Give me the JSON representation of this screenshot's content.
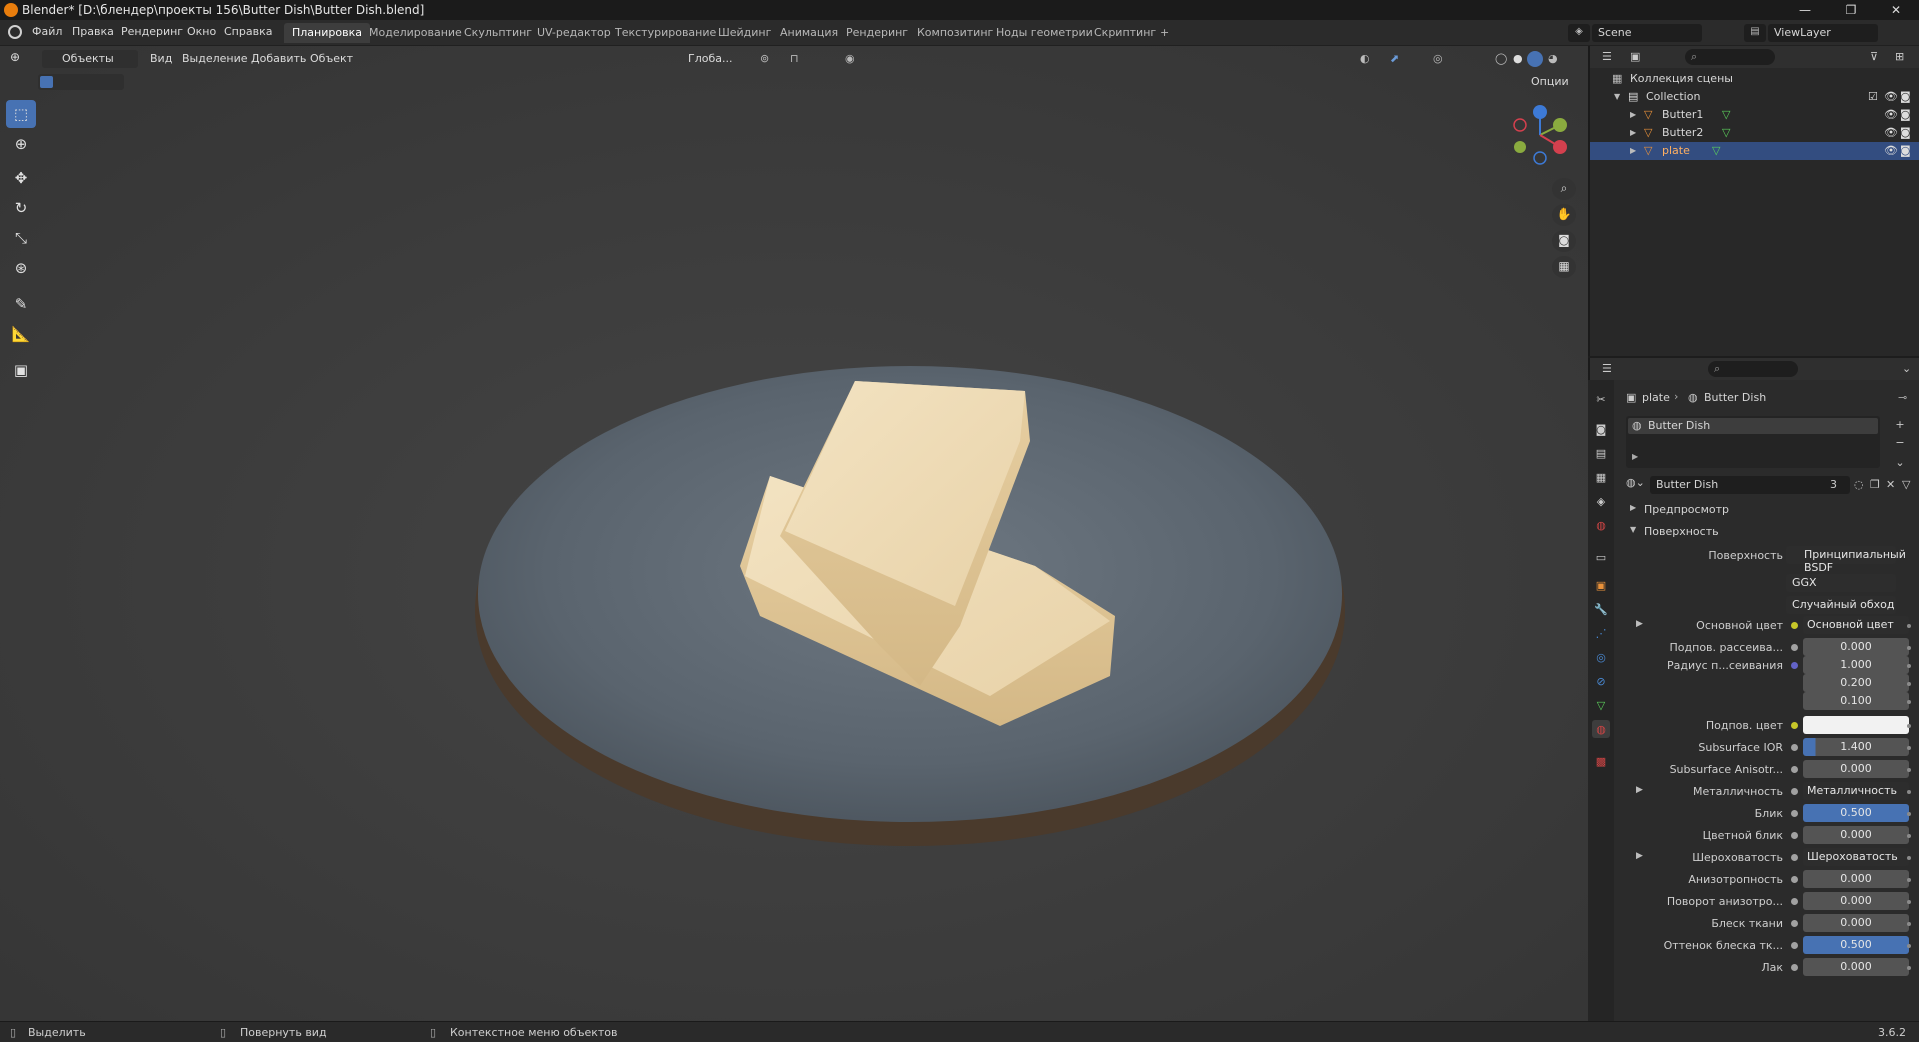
{
  "window": {
    "title": "Blender* [D:\\блендер\\проекты 156\\Butter Dish\\Butter Dish.blend]",
    "minimize": "—",
    "maximize": "❐",
    "close": "✕"
  },
  "menu": [
    "Файл",
    "Правка",
    "Рендеринг",
    "Окно",
    "Справка"
  ],
  "workspaces": [
    "Планировка",
    "Моделирование",
    "Скульптинг",
    "UV-редактор",
    "Текстурирование",
    "Шейдинг",
    "Анимация",
    "Рендеринг",
    "Композитинг",
    "Ноды геометрии",
    "Скриптинг"
  ],
  "workspace_active": "Планировка",
  "workspace_add": "+",
  "scene": {
    "name": "Scene",
    "view_layer": "ViewLayer"
  },
  "viewport_header": {
    "mode": "Объекты",
    "menus": [
      "Вид",
      "Выделение",
      "Добавить",
      "Объект"
    ],
    "transform_orientation": "Глоба...",
    "options": "Опции"
  },
  "outliner": {
    "scene_collection": "Коллекция сцены",
    "collection": "Collection",
    "objects": [
      {
        "name": "Butter1",
        "selected": false
      },
      {
        "name": "Butter2",
        "selected": false
      },
      {
        "name": "plate",
        "selected": true
      }
    ]
  },
  "properties": {
    "breadcrumb_object": "plate",
    "breadcrumb_material": "Butter Dish",
    "slot_name": "Butter Dish",
    "material_name": "Butter Dish",
    "user_count": "3",
    "sections": {
      "preview": "Предпросмотр",
      "surface": "Поверхность"
    },
    "surface_label": "Поверхность",
    "surface_shader": "Принципиальный BSDF",
    "distribution": "GGX",
    "subsurface_method": "Случайный обход",
    "rows": [
      {
        "label": "Основной цвет",
        "value": "Основной цвет",
        "kind": "link",
        "dot": "#c7c729",
        "expand": true
      },
      {
        "label": "Подпов. рассеива...",
        "value": "0.000",
        "kind": "num",
        "dot": "#a1a1a1"
      },
      {
        "label": "Радиус п...сеивания",
        "value": "1.000",
        "kind": "num",
        "dot": "#6363c7"
      },
      {
        "label": "",
        "value": "0.200",
        "kind": "num"
      },
      {
        "label": "",
        "value": "0.100",
        "kind": "num"
      },
      {
        "label": "Подпов. цвет",
        "value": "",
        "kind": "color",
        "dot": "#c7c729"
      },
      {
        "label": "Subsurface IOR",
        "value": "1.400",
        "kind": "partial",
        "dot": "#a1a1a1"
      },
      {
        "label": "Subsurface Anisotr...",
        "value": "0.000",
        "kind": "num",
        "dot": "#a1a1a1"
      },
      {
        "label": "Металличность",
        "value": "Металличность",
        "kind": "link",
        "dot": "#a1a1a1",
        "expand": true
      },
      {
        "label": "Блик",
        "value": "0.500",
        "kind": "full",
        "dot": "#a1a1a1"
      },
      {
        "label": "Цветной блик",
        "value": "0.000",
        "kind": "num",
        "dot": "#a1a1a1"
      },
      {
        "label": "Шероховатость",
        "value": "Шероховатость",
        "kind": "link",
        "dot": "#a1a1a1",
        "expand": true
      },
      {
        "label": "Анизотропность",
        "value": "0.000",
        "kind": "num",
        "dot": "#a1a1a1"
      },
      {
        "label": "Поворот анизотро...",
        "value": "0.000",
        "kind": "num",
        "dot": "#a1a1a1"
      },
      {
        "label": "Блеск ткани",
        "value": "0.000",
        "kind": "num",
        "dot": "#a1a1a1"
      },
      {
        "label": "Оттенок блеска тк...",
        "value": "0.500",
        "kind": "full",
        "dot": "#a1a1a1"
      },
      {
        "label": "Лак",
        "value": "0.000",
        "kind": "num",
        "dot": "#a1a1a1"
      }
    ]
  },
  "statusbar": {
    "select": "Выделить",
    "rotate_view": "Повернуть вид",
    "context_menu": "Контекстное меню объектов",
    "version": "3.6.2"
  },
  "colors": {
    "accent": "#4772b3",
    "selection": "#334d80",
    "viewport_bg": "#3c3c3c",
    "blender_logo": "#e87d0d"
  }
}
